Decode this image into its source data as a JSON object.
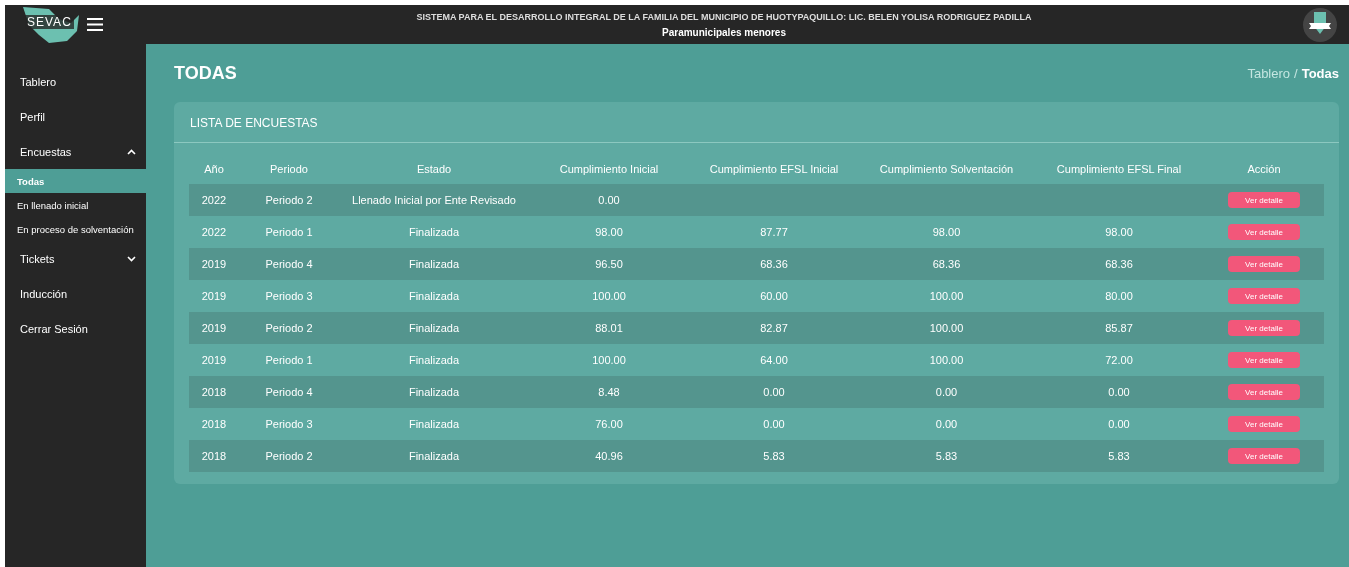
{
  "header": {
    "logo": "SEVAC",
    "title": "SISTEMA PARA EL DESARROLLO INTEGRAL DE LA FAMILIA DEL MUNICIPIO DE HUOTYPAQUILLO: LIC. BELEN YOLISA RODRIGUEZ PADILLA",
    "subtitle": "Paramunicipales menores"
  },
  "sidebar": {
    "items": [
      {
        "kind": "link",
        "label": "Tablero"
      },
      {
        "kind": "link",
        "label": "Perfil"
      },
      {
        "kind": "group",
        "label": "Encuestas",
        "expanded": true,
        "children": [
          {
            "label": "Todas",
            "selected": true
          },
          {
            "label": "En llenado inicial",
            "selected": false
          },
          {
            "label": "En proceso de solventación",
            "selected": false
          }
        ]
      },
      {
        "kind": "group",
        "label": "Tickets",
        "expanded": false
      },
      {
        "kind": "link",
        "label": "Inducción"
      },
      {
        "kind": "link",
        "label": "Cerrar Sesión"
      }
    ]
  },
  "page": {
    "title": "TODAS",
    "breadcrumb": [
      {
        "label": "Tablero",
        "selected": false
      },
      {
        "label": "Todas",
        "selected": true
      }
    ],
    "separator": "/"
  },
  "card": {
    "title": "LISTA DE ENCUESTAS",
    "table": {
      "columns": [
        "Año",
        "Periodo",
        "Estado",
        "Cumplimiento Inicial",
        "Cumplimiento EFSL Inicial",
        "Cumplimiento Solventación",
        "Cumplimiento EFSL Final",
        "Acción"
      ],
      "rows": [
        {
          "cells": [
            "2022",
            "Periodo 2",
            "Llenado Inicial por Ente Revisado",
            "0.00",
            null,
            null,
            null
          ],
          "action": "Ver detalle"
        },
        {
          "cells": [
            "2022",
            "Periodo 1",
            "Finalizada",
            "98.00",
            "87.77",
            "98.00",
            "98.00"
          ],
          "action": "Ver detalle"
        },
        {
          "cells": [
            "2019",
            "Periodo 4",
            "Finalizada",
            "96.50",
            "68.36",
            "68.36",
            "68.36"
          ],
          "action": "Ver detalle"
        },
        {
          "cells": [
            "2019",
            "Periodo 3",
            "Finalizada",
            "100.00",
            "60.00",
            "100.00",
            "80.00"
          ],
          "action": "Ver detalle"
        },
        {
          "cells": [
            "2019",
            "Periodo 2",
            "Finalizada",
            "88.01",
            "82.87",
            "100.00",
            "85.87"
          ],
          "action": "Ver detalle"
        },
        {
          "cells": [
            "2019",
            "Periodo 1",
            "Finalizada",
            "100.00",
            "64.00",
            "100.00",
            "72.00"
          ],
          "action": "Ver detalle"
        },
        {
          "cells": [
            "2018",
            "Periodo 4",
            "Finalizada",
            "8.48",
            "0.00",
            "0.00",
            "0.00"
          ],
          "action": "Ver detalle"
        },
        {
          "cells": [
            "2018",
            "Periodo 3",
            "Finalizada",
            "76.00",
            "0.00",
            "0.00",
            "0.00"
          ],
          "action": "Ver detalle"
        },
        {
          "cells": [
            "2018",
            "Periodo 2",
            "Finalizada",
            "40.96",
            "5.83",
            "5.83",
            "5.83"
          ],
          "action": "Ver detalle"
        }
      ]
    }
  }
}
